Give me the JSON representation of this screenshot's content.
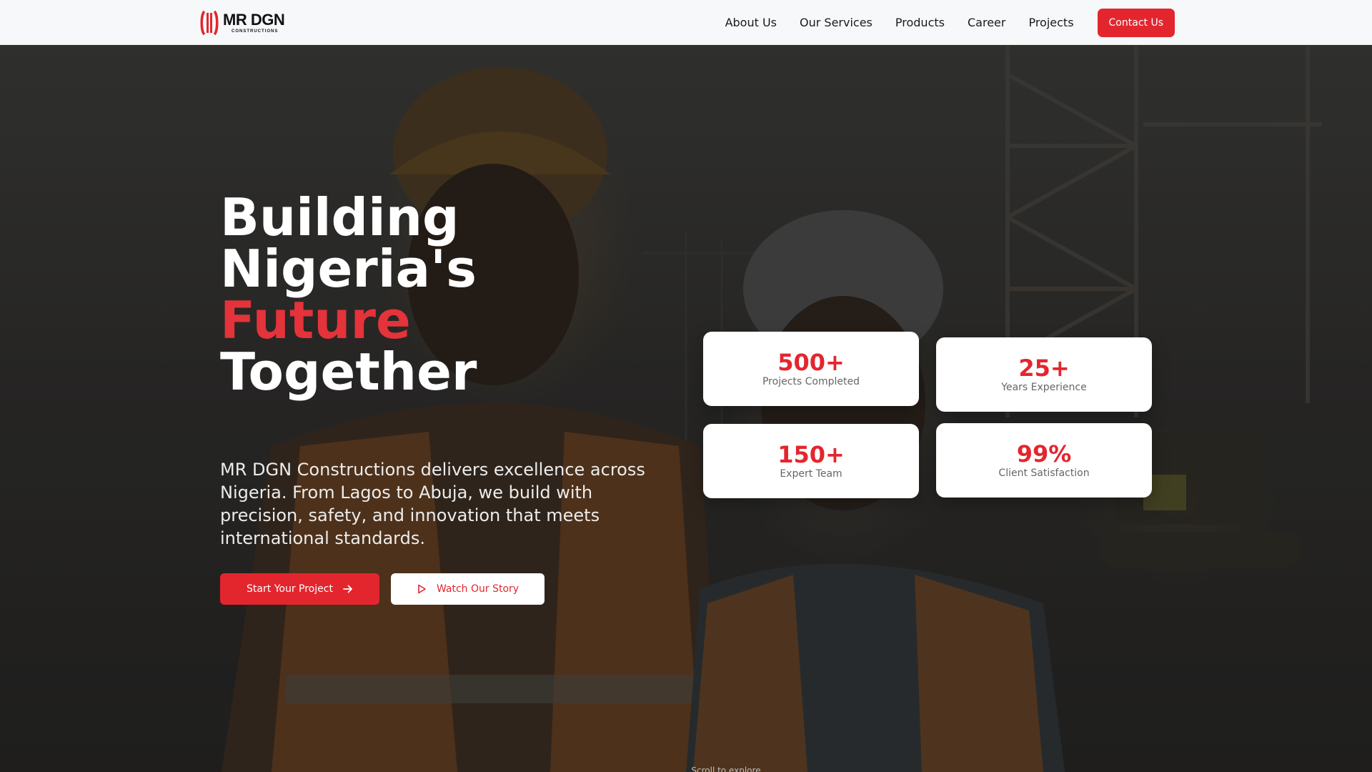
{
  "header": {
    "logo_title": "MR DGN",
    "logo_subtitle": "CONSTRUCTIONS",
    "nav": [
      "About Us",
      "Our Services",
      "Products",
      "Career",
      "Projects"
    ],
    "contact_label": "Contact Us"
  },
  "hero": {
    "headline_line1": "Building",
    "headline_line2": "Nigeria's",
    "headline_accent": "Future",
    "headline_line4": "Together",
    "description": "MR DGN Constructions delivers excellence across Nigeria. From Lagos to Abuja, we build with precision, safety, and innovation that meets international standards.",
    "primary_cta": "Start Your Project",
    "secondary_cta": "Watch Our Story",
    "scroll_hint": "Scroll to explore"
  },
  "stats": [
    {
      "value": "500+",
      "label": "Projects Completed"
    },
    {
      "value": "25+",
      "label": "Years Experience"
    },
    {
      "value": "150+",
      "label": "Expert Team"
    },
    {
      "value": "99%",
      "label": "Client Satisfaction"
    }
  ],
  "colors": {
    "accent": "#e3262e",
    "header_bg": "#f7f8fa",
    "card_bg": "#ffffff"
  },
  "icons": [
    "logo-mark-icon",
    "arrow-right-icon",
    "play-icon"
  ]
}
